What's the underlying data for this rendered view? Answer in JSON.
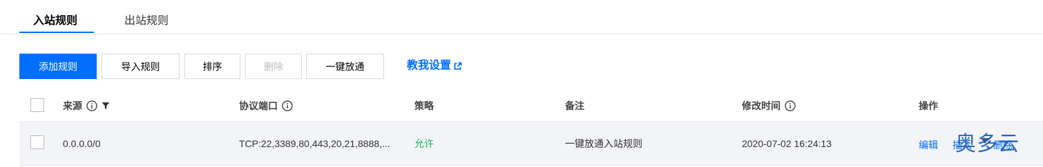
{
  "tabs": [
    {
      "label": "入站规则",
      "active": true
    },
    {
      "label": "出站规则",
      "active": false
    }
  ],
  "toolbar": {
    "add_label": "添加规则",
    "import_label": "导入规则",
    "sort_label": "排序",
    "delete_label": "删除",
    "one_click_label": "一键放通",
    "help_label": "教我设置"
  },
  "table": {
    "columns": {
      "source": "来源",
      "protocol_port": "协议端口",
      "strategy": "策略",
      "remark": "备注",
      "modified_time": "修改时间",
      "operation": "操作"
    },
    "rows": [
      {
        "source": "0.0.0.0/0",
        "protocol_port": "TCP:22,3389,80,443,20,21,8888,...",
        "strategy": "允许",
        "remark": "一键放通入站规则",
        "modified_time": "2020-07-02 16:24:13",
        "actions": {
          "edit": "编辑",
          "insert": "插入",
          "delete": "删除"
        }
      }
    ]
  },
  "watermark": "奥多云",
  "colors": {
    "accent": "#006eff",
    "allow": "#0abf5b",
    "row_bg": "#f3f4f7"
  }
}
